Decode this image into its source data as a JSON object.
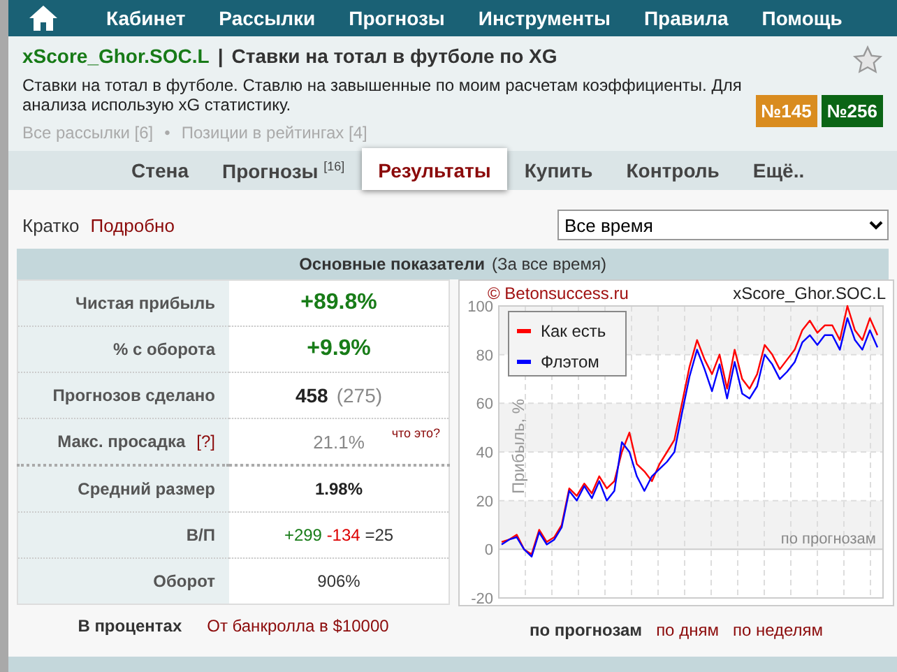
{
  "nav": {
    "items": [
      "Кабинет",
      "Рассылки",
      "Прогнозы",
      "Инструменты",
      "Правила",
      "Помощь"
    ]
  },
  "header": {
    "author": "xScore_Ghor.SOC.L",
    "separator": "|",
    "title": "Ставки на тотал в футболе по XG",
    "description": "Ставки на тотал в футболе. Ставлю на завышенные по моим расчетам коэффициенты. Для анализа использую xG статистику.",
    "links": [
      "Все рассылки [6]",
      "Позиции в рейтингах [4]"
    ],
    "link_separator": "•",
    "badges": [
      {
        "text": "№145",
        "color": "#d98c1f"
      },
      {
        "text": "№256",
        "color": "#0b6515"
      }
    ],
    "favorite": false
  },
  "subtabs": [
    {
      "label": "Стена",
      "selected": false
    },
    {
      "label": "Прогнозы",
      "count": "[16]",
      "selected": false
    },
    {
      "label": "Результаты",
      "selected": true
    },
    {
      "label": "Купить",
      "selected": false
    },
    {
      "label": "Контроль",
      "selected": false
    },
    {
      "label": "Ещё..",
      "selected": false
    }
  ],
  "views": [
    {
      "label": "Кратко",
      "selected": true
    },
    {
      "label": "Подробно",
      "selected": false
    }
  ],
  "period": {
    "value": "Все время"
  },
  "section": {
    "title": "Основные показатели",
    "subtitle": "(За все время)"
  },
  "stats": [
    {
      "kind": "profit",
      "label": "Чистая прибыль",
      "value": "+89.8%"
    },
    {
      "kind": "profit",
      "label": "% с оборота",
      "value": "+9.9%"
    },
    {
      "kind": "count",
      "label": "Прогнозов сделано",
      "value": "458",
      "secondary": "(275)"
    },
    {
      "kind": "drawdown",
      "label": "Макс. просадка",
      "help": "[?]",
      "value": "21.1%",
      "note": "что это?"
    },
    {
      "kind": "bold",
      "label": "Средний размер",
      "value": "1.98%"
    },
    {
      "kind": "wl",
      "label": "В/П",
      "wins": "+299",
      "losses": "-134",
      "draws": "=25"
    },
    {
      "kind": "plain",
      "label": "Оборот",
      "value": "906%"
    }
  ],
  "units": [
    {
      "label": "В процентах",
      "selected": true
    },
    {
      "label": "От банкролла в $10000",
      "selected": false
    }
  ],
  "chart": {
    "source": "© Betonsuccess.ru",
    "mode_label": "по прогнозам",
    "chart_data": {
      "type": "line",
      "grid": true,
      "legend": true,
      "title": "xScore_Ghor.SOC.L",
      "ylabel": "Прибыль, %",
      "ylim": [
        -20,
        100
      ],
      "yticks": [
        -20,
        0,
        20,
        40,
        60,
        80,
        100
      ],
      "series": [
        {
          "name": "Как есть",
          "color": "#ff0000",
          "values": [
            3,
            4,
            6,
            0,
            -2,
            8,
            3,
            5,
            10,
            25,
            22,
            27,
            23,
            30,
            25,
            28,
            40,
            48,
            35,
            32,
            28,
            35,
            40,
            45,
            60,
            75,
            86,
            78,
            72,
            80,
            66,
            82,
            70,
            66,
            72,
            84,
            80,
            74,
            78,
            82,
            90,
            94,
            89,
            92,
            92,
            86,
            100,
            90,
            86,
            95,
            88
          ]
        },
        {
          "name": "Флэтом",
          "color": "#0000ff",
          "values": [
            2,
            4,
            5,
            0,
            -3,
            7,
            2,
            4,
            9,
            24,
            20,
            26,
            21,
            28,
            20,
            24,
            44,
            40,
            30,
            24,
            30,
            33,
            36,
            40,
            56,
            71,
            82,
            74,
            65,
            76,
            62,
            77,
            64,
            62,
            67,
            80,
            76,
            70,
            73,
            77,
            85,
            88,
            84,
            88,
            88,
            82,
            95,
            86,
            82,
            90,
            83
          ]
        }
      ]
    }
  },
  "modes": [
    {
      "label": "по прогнозам",
      "selected": true
    },
    {
      "label": "по дням",
      "selected": false
    },
    {
      "label": "по неделям",
      "selected": false
    }
  ]
}
